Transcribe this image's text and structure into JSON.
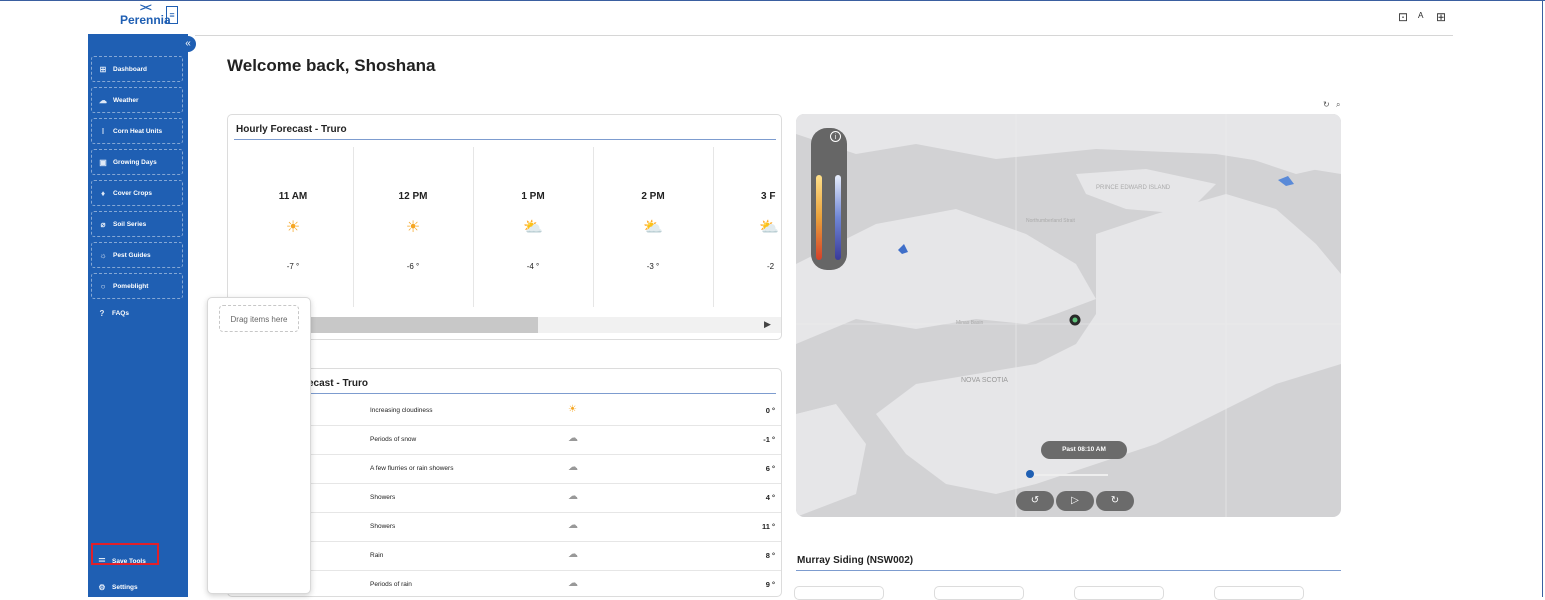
{
  "app": {
    "brand": "Perennia",
    "brand_mark": "><"
  },
  "header_icons": [
    "store-icon",
    "user-icon",
    "apps-icon"
  ],
  "sidebar": {
    "collapse_label": "«",
    "items": [
      {
        "label": "Dashboard",
        "icon": "dashboard-icon"
      },
      {
        "label": "Weather",
        "icon": "weather-icon"
      },
      {
        "label": "Corn Heat Units",
        "icon": "thermometer-icon"
      },
      {
        "label": "Growing Days",
        "icon": "calendar-icon"
      },
      {
        "label": "Cover Crops",
        "icon": "sprout-icon"
      },
      {
        "label": "Soil Series",
        "icon": "soil-icon"
      },
      {
        "label": "Pest Guides",
        "icon": "bug-icon"
      },
      {
        "label": "Pomeblight",
        "icon": "apple-icon"
      }
    ],
    "faq": {
      "label": "FAQs",
      "icon": "help-icon"
    },
    "save_tools": {
      "label": "Save Tools",
      "icon": "checklist-icon"
    },
    "settings": {
      "label": "Settings",
      "icon": "gear-icon"
    }
  },
  "welcome": "Welcome back, Shoshana",
  "hourly": {
    "title": "Hourly Forecast - Truro",
    "hours": [
      {
        "time": "11 AM",
        "icon": "sun-icon",
        "temp": "-7 °"
      },
      {
        "time": "12 PM",
        "icon": "sun-icon",
        "temp": "-6 °"
      },
      {
        "time": "1 PM",
        "icon": "sun-cloud-icon",
        "temp": "-4 °"
      },
      {
        "time": "2 PM",
        "icon": "sun-cloud-icon",
        "temp": "-3 °"
      },
      {
        "time": "3 F",
        "icon": "sun-cloud-icon",
        "temp": "-2"
      }
    ]
  },
  "drag": {
    "placeholder": "Drag items here"
  },
  "daily": {
    "title": "ecast - Truro",
    "rows": [
      {
        "condition": "Increasing cloudiness",
        "icon": "sun-cloud-icon",
        "temp": "0 °"
      },
      {
        "condition": "Periods of snow",
        "icon": "snow-icon",
        "temp": "-1 °"
      },
      {
        "condition": "A few flurries or rain showers",
        "icon": "mixed-icon",
        "temp": "6 °"
      },
      {
        "condition": "Showers",
        "icon": "rain-icon",
        "temp": "4 °"
      },
      {
        "condition": "Showers",
        "icon": "rain-icon",
        "temp": "11 °"
      },
      {
        "condition": "Rain",
        "icon": "rain-icon",
        "temp": "8 °"
      },
      {
        "condition": "Periods of rain",
        "icon": "rain-icon",
        "temp": "9 °"
      }
    ]
  },
  "map": {
    "tools": [
      "refresh-icon",
      "search-icon"
    ],
    "labels": {
      "pei": "PRINCE\nEDWARD\nISLAND",
      "strait": "Northumberland\nStrait",
      "ns": "NOVA SCOTIA",
      "basin": "Minas Basin"
    },
    "time_label": "Past 08:10 AM",
    "buttons": [
      "rewind-icon",
      "play-icon",
      "forward-icon"
    ]
  },
  "station": {
    "title": "Murray Siding (NSW002)"
  }
}
